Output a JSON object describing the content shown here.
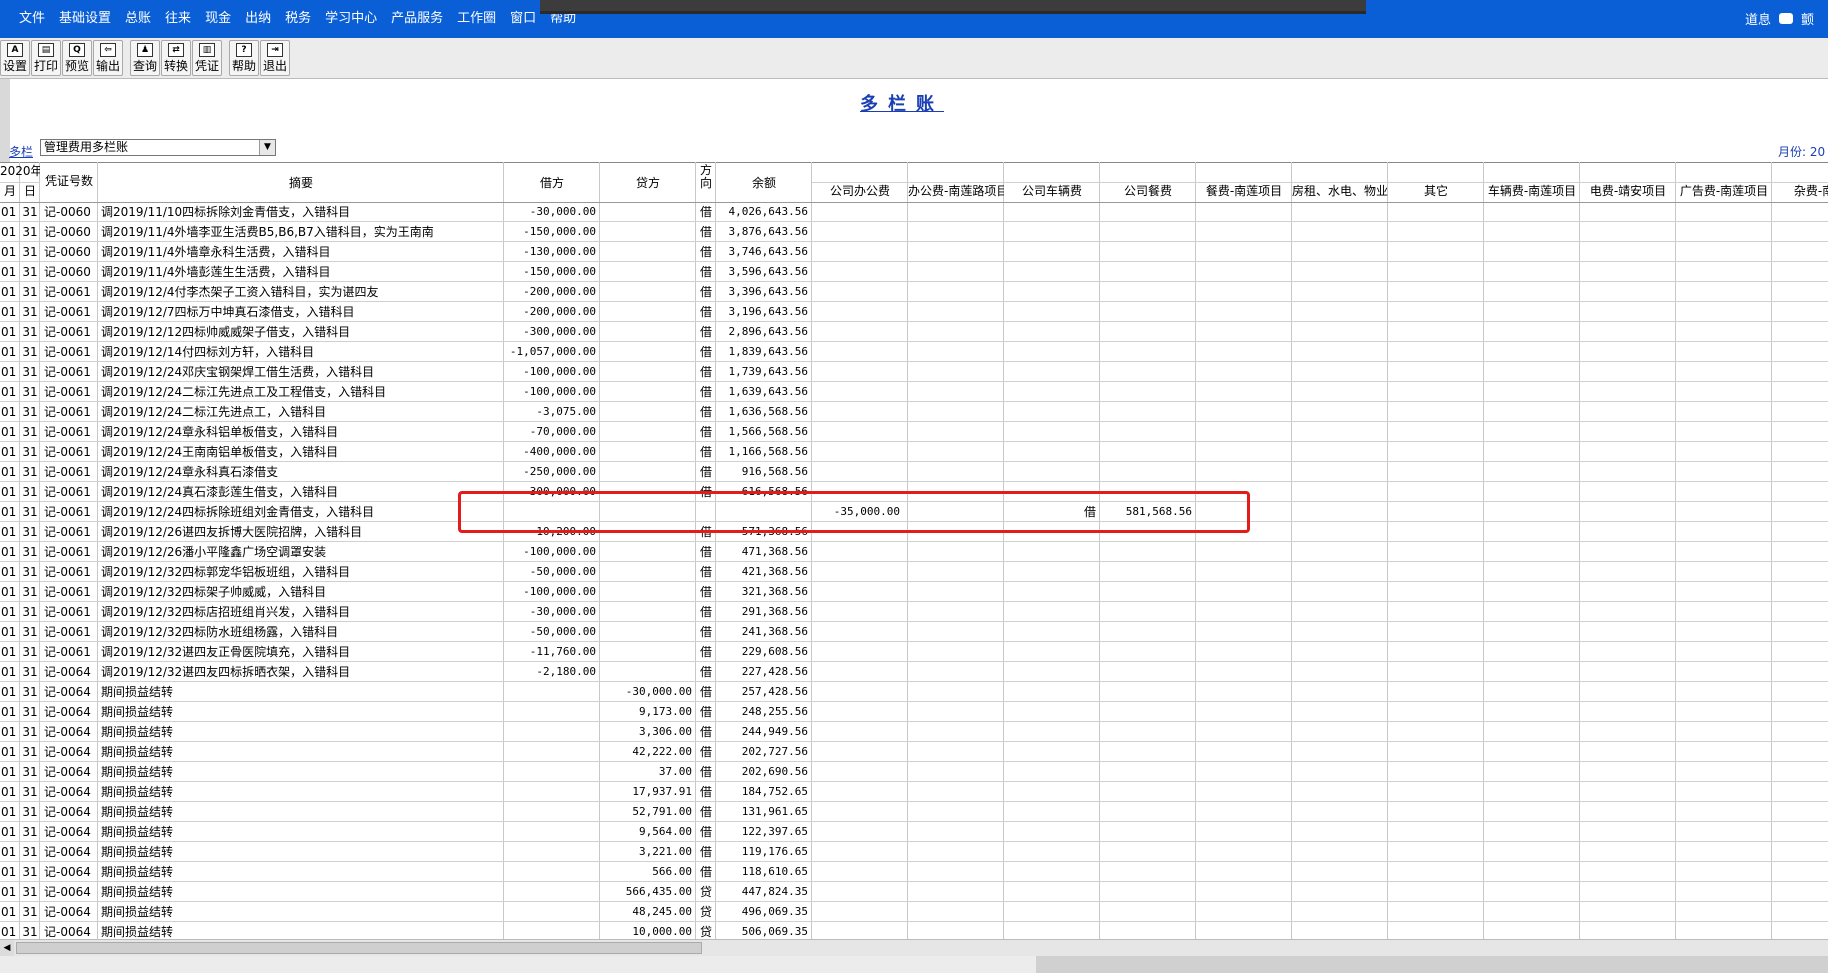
{
  "menu": {
    "items": [
      "文件",
      "基础设置",
      "总账",
      "往来",
      "现金",
      "出纳",
      "税务",
      "学习中心",
      "产品服务",
      "工作圈",
      "窗口",
      "帮助"
    ],
    "right_text": "道息",
    "right_truncated": "颤"
  },
  "toolbar": [
    {
      "label": "设置",
      "icon": "settings-icon"
    },
    {
      "label": "打印",
      "icon": "print-icon"
    },
    {
      "label": "预览",
      "icon": "preview-icon"
    },
    {
      "label": "输出",
      "icon": "export-icon"
    },
    {
      "label": "查询",
      "icon": "search-icon"
    },
    {
      "label": "转换",
      "icon": "convert-icon"
    },
    {
      "label": "凭证",
      "icon": "voucher-icon"
    },
    {
      "label": "帮助",
      "icon": "help-icon"
    },
    {
      "label": "退出",
      "icon": "exit-icon"
    }
  ],
  "report": {
    "title": "多栏账",
    "multi_label": "多栏",
    "multi_select_value": "管理费用多栏账",
    "month_label": "月份: 20"
  },
  "columns": {
    "year": "2020年",
    "month": "月",
    "day": "日",
    "voucher": "凭证号数",
    "summary": "摘要",
    "debit": "借方",
    "credit": "贷方",
    "direction": "方向",
    "balance": "余额",
    "detail": [
      "公司办公费",
      "办公费-南莲路项目",
      "公司车辆费",
      "公司餐费",
      "餐费-南莲项目",
      "房租、水电、物业费",
      "其它",
      "车辆费-南莲项目",
      "电费-靖安项目",
      "广告费-南莲项目",
      "杂费-南莲"
    ]
  },
  "rows": [
    {
      "m": "01",
      "d": "31",
      "v": "记-0060",
      "s": "调2019/11/10四标拆除刘金青借支，入错科目",
      "dr": "-30,000.00",
      "cr": "",
      "dir": "借",
      "bal": "4,026,643.56"
    },
    {
      "m": "01",
      "d": "31",
      "v": "记-0060",
      "s": "调2019/11/4外墙李亚生活费B5,B6,B7入错科目，实为王南南",
      "dr": "-150,000.00",
      "cr": "",
      "dir": "借",
      "bal": "3,876,643.56"
    },
    {
      "m": "01",
      "d": "31",
      "v": "记-0060",
      "s": "调2019/11/4外墙章永科生活费，入错科目",
      "dr": "-130,000.00",
      "cr": "",
      "dir": "借",
      "bal": "3,746,643.56"
    },
    {
      "m": "01",
      "d": "31",
      "v": "记-0060",
      "s": "调2019/11/4外墙彭莲生生活费，入错科目",
      "dr": "-150,000.00",
      "cr": "",
      "dir": "借",
      "bal": "3,596,643.56"
    },
    {
      "m": "01",
      "d": "31",
      "v": "记-0061",
      "s": "调2019/12/4付李杰架子工资入错科目，实为谌四友",
      "dr": "-200,000.00",
      "cr": "",
      "dir": "借",
      "bal": "3,396,643.56"
    },
    {
      "m": "01",
      "d": "31",
      "v": "记-0061",
      "s": "调2019/12/7四标万中坤真石漆借支，入错科目",
      "dr": "-200,000.00",
      "cr": "",
      "dir": "借",
      "bal": "3,196,643.56"
    },
    {
      "m": "01",
      "d": "31",
      "v": "记-0061",
      "s": "调2019/12/12四标帅威威架子借支，入错科目",
      "dr": "-300,000.00",
      "cr": "",
      "dir": "借",
      "bal": "2,896,643.56"
    },
    {
      "m": "01",
      "d": "31",
      "v": "记-0061",
      "s": "调2019/12/14付四标刘方轩，入错科目",
      "dr": "-1,057,000.00",
      "cr": "",
      "dir": "借",
      "bal": "1,839,643.56"
    },
    {
      "m": "01",
      "d": "31",
      "v": "记-0061",
      "s": "调2019/12/24邓庆宝钢架焊工借生活费，入错科目",
      "dr": "-100,000.00",
      "cr": "",
      "dir": "借",
      "bal": "1,739,643.56"
    },
    {
      "m": "01",
      "d": "31",
      "v": "记-0061",
      "s": "调2019/12/24二标江先进点工及工程借支，入错科目",
      "dr": "-100,000.00",
      "cr": "",
      "dir": "借",
      "bal": "1,639,643.56"
    },
    {
      "m": "01",
      "d": "31",
      "v": "记-0061",
      "s": "调2019/12/24二标江先进点工，入错科目",
      "dr": "-3,075.00",
      "cr": "",
      "dir": "借",
      "bal": "1,636,568.56"
    },
    {
      "m": "01",
      "d": "31",
      "v": "记-0061",
      "s": "调2019/12/24章永科铝单板借支，入错科目",
      "dr": "-70,000.00",
      "cr": "",
      "dir": "借",
      "bal": "1,566,568.56"
    },
    {
      "m": "01",
      "d": "31",
      "v": "记-0061",
      "s": "调2019/12/24王南南铝单板借支，入错科目",
      "dr": "-400,000.00",
      "cr": "",
      "dir": "借",
      "bal": "1,166,568.56"
    },
    {
      "m": "01",
      "d": "31",
      "v": "记-0061",
      "s": "调2019/12/24章永科真石漆借支",
      "dr": "-250,000.00",
      "cr": "",
      "dir": "借",
      "bal": "916,568.56"
    },
    {
      "m": "01",
      "d": "31",
      "v": "记-0061",
      "s": "调2019/12/24真石漆彭莲生借支，入错科目",
      "dr": "-300,000.00",
      "cr": "",
      "dir": "借",
      "bal": "616,568.56"
    },
    {
      "m": "01",
      "d": "31",
      "v": "记-0061",
      "s": "调2019/12/24四标拆除班组刘金青借支，入错科目",
      "dr": "",
      "cr": "",
      "dir": "",
      "bal": "",
      "highlight": true
    },
    {
      "m": "01",
      "d": "31",
      "v": "记-0061",
      "s": "调2019/12/26谌四友拆博大医院招牌，入错科目",
      "dr": "-10,200.00",
      "cr": "",
      "dir": "借",
      "bal": "571,368.56"
    },
    {
      "m": "01",
      "d": "31",
      "v": "记-0061",
      "s": "调2019/12/26潘小平隆鑫广场空调罩安装",
      "dr": "-100,000.00",
      "cr": "",
      "dir": "借",
      "bal": "471,368.56"
    },
    {
      "m": "01",
      "d": "31",
      "v": "记-0061",
      "s": "调2019/12/32四标郭宠华铝板班组，入错科目",
      "dr": "-50,000.00",
      "cr": "",
      "dir": "借",
      "bal": "421,368.56"
    },
    {
      "m": "01",
      "d": "31",
      "v": "记-0061",
      "s": "调2019/12/32四标架子帅威威，入错科目",
      "dr": "-100,000.00",
      "cr": "",
      "dir": "借",
      "bal": "321,368.56"
    },
    {
      "m": "01",
      "d": "31",
      "v": "记-0061",
      "s": "调2019/12/32四标店招班组肖兴发，入错科目",
      "dr": "-30,000.00",
      "cr": "",
      "dir": "借",
      "bal": "291,368.56"
    },
    {
      "m": "01",
      "d": "31",
      "v": "记-0061",
      "s": "调2019/12/32四标防水班组杨露，入错科目",
      "dr": "-50,000.00",
      "cr": "",
      "dir": "借",
      "bal": "241,368.56"
    },
    {
      "m": "01",
      "d": "31",
      "v": "记-0061",
      "s": "调2019/12/32谌四友正骨医院填充，入错科目",
      "dr": "-11,760.00",
      "cr": "",
      "dir": "借",
      "bal": "229,608.56"
    },
    {
      "m": "01",
      "d": "31",
      "v": "记-0064",
      "s": "调2019/12/32谌四友四标拆晒衣架，入错科目",
      "dr": "-2,180.00",
      "cr": "",
      "dir": "借",
      "bal": "227,428.56"
    },
    {
      "m": "01",
      "d": "31",
      "v": "记-0064",
      "s": "期间损益结转",
      "dr": "",
      "cr": "-30,000.00",
      "dir": "借",
      "bal": "257,428.56"
    },
    {
      "m": "01",
      "d": "31",
      "v": "记-0064",
      "s": "期间损益结转",
      "dr": "",
      "cr": "9,173.00",
      "dir": "借",
      "bal": "248,255.56"
    },
    {
      "m": "01",
      "d": "31",
      "v": "记-0064",
      "s": "期间损益结转",
      "dr": "",
      "cr": "3,306.00",
      "dir": "借",
      "bal": "244,949.56"
    },
    {
      "m": "01",
      "d": "31",
      "v": "记-0064",
      "s": "期间损益结转",
      "dr": "",
      "cr": "42,222.00",
      "dir": "借",
      "bal": "202,727.56"
    },
    {
      "m": "01",
      "d": "31",
      "v": "记-0064",
      "s": "期间损益结转",
      "dr": "",
      "cr": "37.00",
      "dir": "借",
      "bal": "202,690.56"
    },
    {
      "m": "01",
      "d": "31",
      "v": "记-0064",
      "s": "期间损益结转",
      "dr": "",
      "cr": "17,937.91",
      "dir": "借",
      "bal": "184,752.65"
    },
    {
      "m": "01",
      "d": "31",
      "v": "记-0064",
      "s": "期间损益结转",
      "dr": "",
      "cr": "52,791.00",
      "dir": "借",
      "bal": "131,961.65"
    },
    {
      "m": "01",
      "d": "31",
      "v": "记-0064",
      "s": "期间损益结转",
      "dr": "",
      "cr": "9,564.00",
      "dir": "借",
      "bal": "122,397.65"
    },
    {
      "m": "01",
      "d": "31",
      "v": "记-0064",
      "s": "期间损益结转",
      "dr": "",
      "cr": "3,221.00",
      "dir": "借",
      "bal": "119,176.65"
    },
    {
      "m": "01",
      "d": "31",
      "v": "记-0064",
      "s": "期间损益结转",
      "dr": "",
      "cr": "566.00",
      "dir": "借",
      "bal": "118,610.65"
    },
    {
      "m": "01",
      "d": "31",
      "v": "记-0064",
      "s": "期间损益结转",
      "dr": "",
      "cr": "566,435.00",
      "dir": "贷",
      "bal": "447,824.35"
    },
    {
      "m": "01",
      "d": "31",
      "v": "记-0064",
      "s": "期间损益结转",
      "dr": "",
      "cr": "48,245.00",
      "dir": "贷",
      "bal": "496,069.35"
    },
    {
      "m": "01",
      "d": "31",
      "v": "记-0064",
      "s": "期间损益结转",
      "dr": "",
      "cr": "10,000.00",
      "dir": "贷",
      "bal": "506,069.35"
    }
  ],
  "overlay_row": {
    "amount": "-35,000.00",
    "direction": "借",
    "balance": "581,568.56"
  }
}
